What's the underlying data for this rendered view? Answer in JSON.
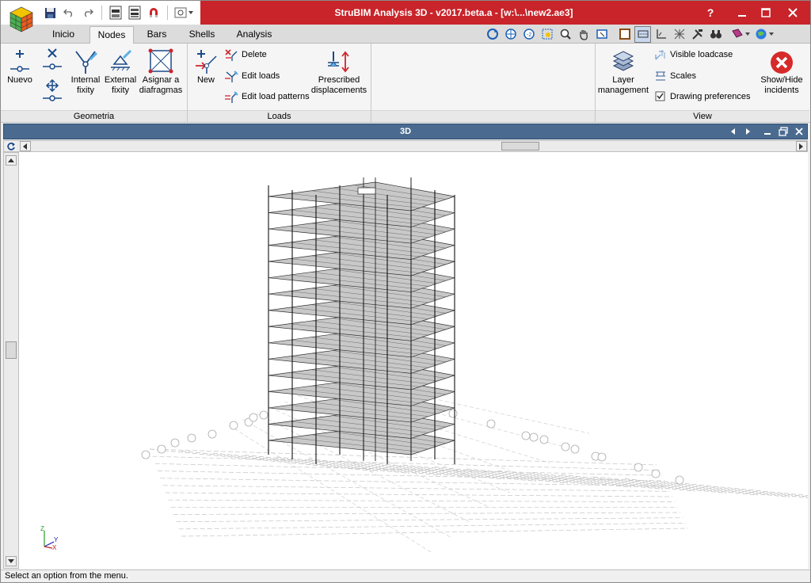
{
  "titlebar": {
    "title": "StruBIM Analysis 3D - v2017.beta.a - [w:\\...\\new2.ae3]",
    "help": "?"
  },
  "tabs": [
    "Inicio",
    "Nodes",
    "Bars",
    "Shells",
    "Analysis"
  ],
  "active_tab": "Nodes",
  "ribbon": {
    "geometria": {
      "label": "Geometria",
      "nuevo": "Nuevo",
      "internal_fixity_1": "Internal",
      "internal_fixity_2": "fixity",
      "external_fixity_1": "External",
      "external_fixity_2": "fixity",
      "asignar_1": "Asignar a",
      "asignar_2": "diafragmas"
    },
    "loads": {
      "label": "Loads",
      "new": "New",
      "delete": "Delete",
      "edit_loads": "Edit loads",
      "edit_load_patterns": "Edit load patterns",
      "prescribed_1": "Prescribed",
      "prescribed_2": "displacements"
    },
    "view": {
      "label": "View",
      "layer_1": "Layer",
      "layer_2": "management",
      "visible_loadcase": "Visible loadcase",
      "scales": "Scales",
      "drawing_preferences": "Drawing preferences",
      "showhide_1": "Show/Hide",
      "showhide_2": "incidents"
    }
  },
  "document": {
    "title": "3D"
  },
  "axis_labels": {
    "z": "Z",
    "y": "Y",
    "x": "X"
  },
  "status": {
    "text": "Select an option from the menu."
  },
  "colors": {
    "title_red": "#c8242a",
    "doc_bar": "#4a6b8f",
    "slab": "#c8c8c8"
  }
}
